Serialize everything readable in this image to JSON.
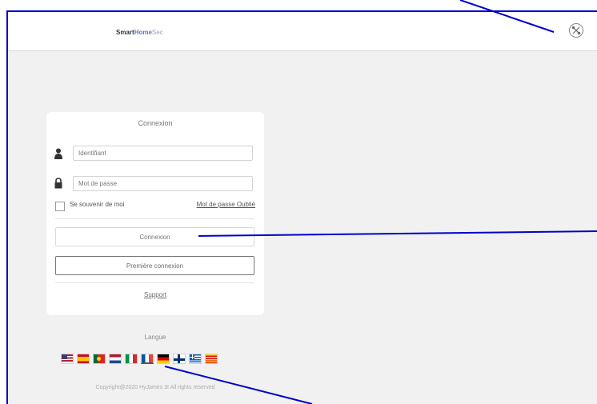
{
  "header": {
    "brand_part1": "Smart",
    "brand_part2": "Home",
    "brand_part3": "Sec",
    "tools_icon": "tools-icon"
  },
  "login": {
    "title": "Connexion",
    "username_placeholder": "Identifiant",
    "password_placeholder": "Mot de passe",
    "remember_label": "Se souvenir de moi",
    "forgot_label": "Mot de passe Oublié",
    "login_button": "Connexion",
    "first_login_button": "Première connexion",
    "support_label": "Support"
  },
  "language": {
    "label": "Langue",
    "selected_index": 5,
    "flags": [
      {
        "name": "en-us-flag-icon"
      },
      {
        "name": "es-flag-icon"
      },
      {
        "name": "pt-flag-icon"
      },
      {
        "name": "nl-flag-icon"
      },
      {
        "name": "it-flag-icon"
      },
      {
        "name": "fr-flag-icon"
      },
      {
        "name": "de-flag-icon"
      },
      {
        "name": "fi-flag-icon"
      },
      {
        "name": "gr-flag-icon"
      },
      {
        "name": "ca-flag-icon"
      }
    ]
  },
  "footer": {
    "copyright": "Copyright@2020 HyJames 3I  All rights reserved"
  },
  "colors": {
    "accent": "#6a78b0",
    "overlay": "#0000cc"
  }
}
